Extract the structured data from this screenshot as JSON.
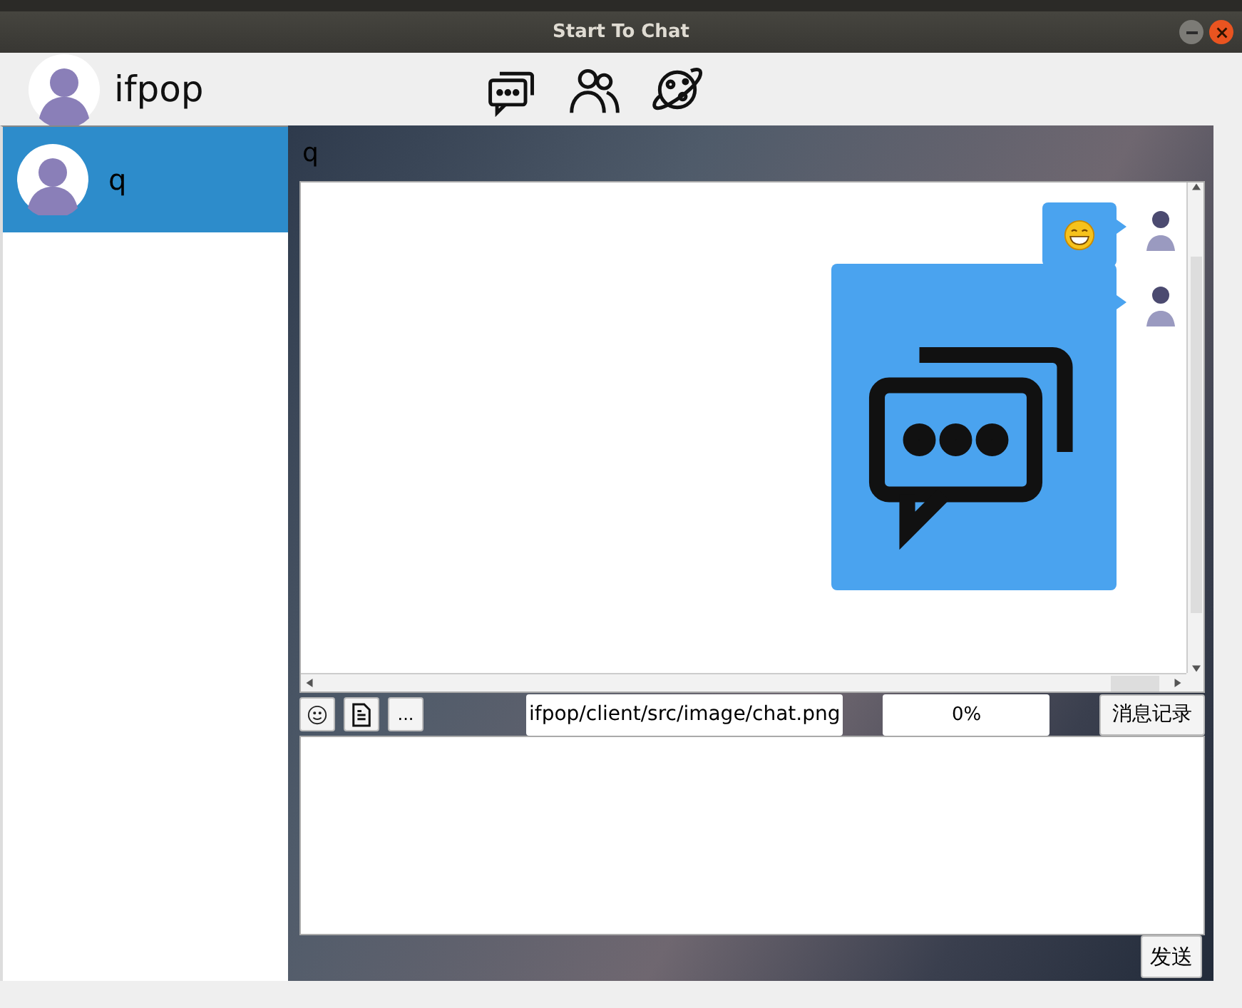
{
  "window": {
    "title": "Start To Chat"
  },
  "profile": {
    "name": "ifpop"
  },
  "nav_icons": [
    {
      "kind": "chat"
    },
    {
      "kind": "friends"
    },
    {
      "kind": "planet"
    }
  ],
  "contacts": [
    {
      "name": "q",
      "selected": true
    }
  ],
  "chat": {
    "title": "q",
    "messages": [
      {
        "kind": "emoji"
      },
      {
        "kind": "image"
      }
    ],
    "tool_buttons": [
      {
        "kind": "emoji"
      },
      {
        "kind": "file"
      },
      {
        "kind": "more",
        "label": "..."
      }
    ],
    "file_path": "ifpop/client/src/image/chat.png",
    "progress": {
      "level": 0,
      "reading": "0%"
    },
    "history_button": "消息记录",
    "send_button": "发送"
  }
}
